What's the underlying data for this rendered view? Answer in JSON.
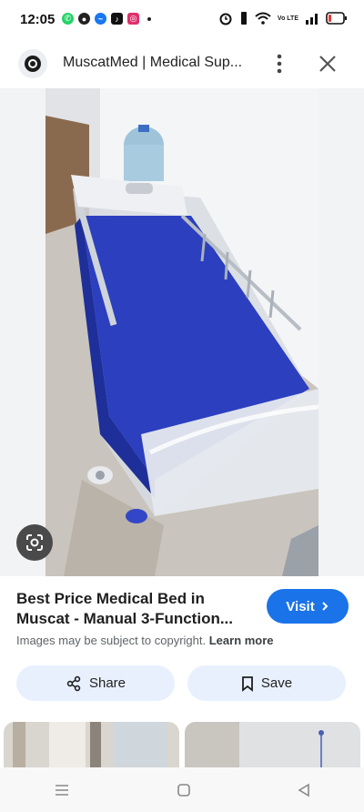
{
  "status_bar": {
    "time": "12:05",
    "notification_icons": [
      "whatsapp-icon",
      "messenger-icon",
      "messenger-icon",
      "tiktok-icon",
      "instagram-icon"
    ],
    "network": "Vo LTE"
  },
  "header": {
    "title": "MuscatMed | Medical Sup..."
  },
  "result": {
    "title": "Best Price Medical Bed in Muscat - Manual 3-Function...",
    "visit_label": "Visit",
    "copyright_text": "Images may be subject to copyright.",
    "learn_more": "Learn more"
  },
  "actions": {
    "share_label": "Share",
    "save_label": "Save"
  },
  "colors": {
    "accent": "#1a73e8",
    "button_bg": "#e8f0fe",
    "mattress": "#2b3fbf"
  }
}
